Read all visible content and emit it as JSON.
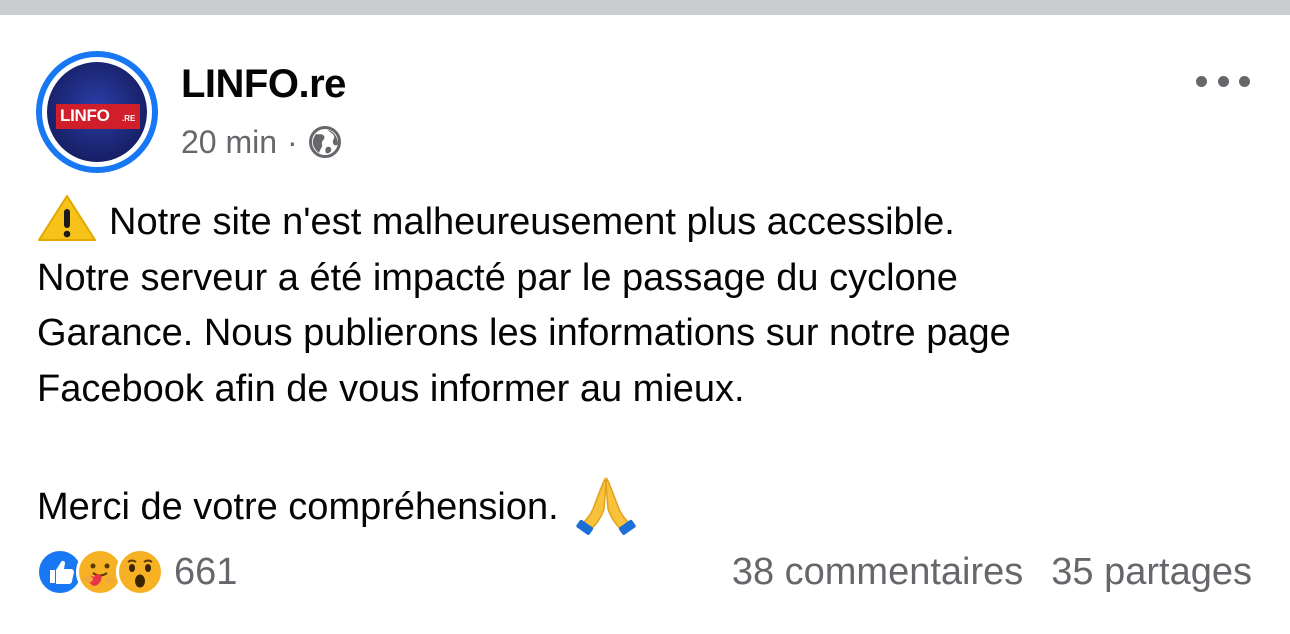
{
  "post": {
    "page_name": "LINFO.re",
    "avatar": {
      "logo_text": "LINFO",
      "logo_suffix": ".RE"
    },
    "time": "20 min",
    "separator": "·",
    "audience_icon": "globe-icon",
    "more_icon": "more-options-icon",
    "body": {
      "line1": "Notre site n'est malheureusement plus accessible.",
      "line2": "Notre serveur a été impacté par le passage du cyclone",
      "line3": "Garance. Nous publierons les informations sur notre page",
      "line4": "Facebook afin de vous informer au mieux.",
      "line5": "Merci de votre compréhension."
    },
    "icons": {
      "warning": "warning-emoji-icon",
      "pray": "folded-hands-emoji-icon"
    }
  },
  "footer": {
    "reactions": [
      "like-reaction-icon",
      "care-reaction-icon",
      "wow-reaction-icon"
    ],
    "reaction_count": "661",
    "comments": "38 commentaires",
    "shares": "35 partages"
  },
  "colors": {
    "brand_blue": "#1877f2",
    "secondary_text": "#65676b",
    "primary_text": "#050505",
    "logo_red": "#d01f2a"
  }
}
